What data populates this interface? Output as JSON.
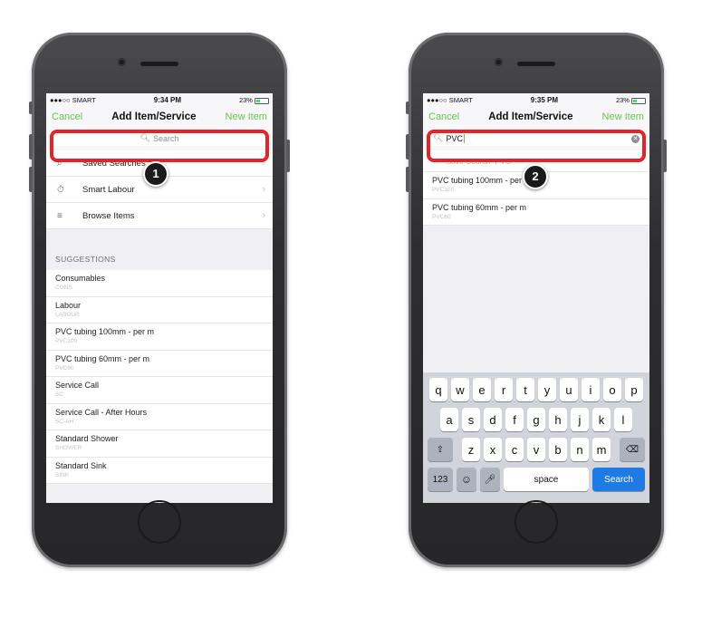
{
  "left": {
    "status": {
      "carrier": "●●●○○ SMART",
      "wifi": "wifi",
      "time": "9:34 PM",
      "battery": "23%"
    },
    "nav": {
      "cancel": "Cancel",
      "title": "Add Item/Service",
      "new_item": "New Item"
    },
    "search": {
      "placeholder": "Search"
    },
    "badge": "1",
    "menu": [
      {
        "icon": "search-icon",
        "label": "Saved Searches"
      },
      {
        "icon": "stopwatch-icon",
        "label": "Smart Labour"
      },
      {
        "icon": "list-icon",
        "label": "Browse Items"
      }
    ],
    "suggestions_header": "SUGGESTIONS",
    "suggestions": [
      {
        "name": "Consumables",
        "code": "CONS"
      },
      {
        "name": "Labour",
        "code": "LABOUR"
      },
      {
        "name": "PVC tubing 100mm - per m",
        "code": "PVC100"
      },
      {
        "name": "PVC tubing 60mm - per m",
        "code": "PVC60"
      },
      {
        "name": "Service Call",
        "code": "SC"
      },
      {
        "name": "Service Call - After Hours",
        "code": "SC-AH"
      },
      {
        "name": "Standard Shower",
        "code": "SHOWER"
      },
      {
        "name": "Standard Sink",
        "code": "SINK"
      }
    ]
  },
  "right": {
    "status": {
      "carrier": "●●●○○ SMART",
      "wifi": "wifi",
      "time": "9:35 PM",
      "battery": "23%"
    },
    "nav": {
      "cancel": "Cancel",
      "title": "Add Item/Service",
      "new_item": "New Item"
    },
    "search": {
      "value": "PVC"
    },
    "badge": "2",
    "save_search": "Save Search \"PVC\"",
    "results": [
      {
        "name": "PVC tubing 100mm - per m",
        "code": "PVC100"
      },
      {
        "name": "PVC tubing 60mm - per m",
        "code": "PVC60"
      }
    ],
    "keyboard": {
      "row1": [
        "q",
        "w",
        "e",
        "r",
        "t",
        "y",
        "u",
        "i",
        "o",
        "p"
      ],
      "row2": [
        "a",
        "s",
        "d",
        "f",
        "g",
        "h",
        "j",
        "k",
        "l"
      ],
      "row3": [
        "z",
        "x",
        "c",
        "v",
        "b",
        "n",
        "m"
      ],
      "numbers": "123",
      "space": "space",
      "search": "Search"
    }
  },
  "colors": {
    "accent": "#6cc24a",
    "highlight": "#e3242b",
    "keyboard_search": "#1e7be4"
  }
}
